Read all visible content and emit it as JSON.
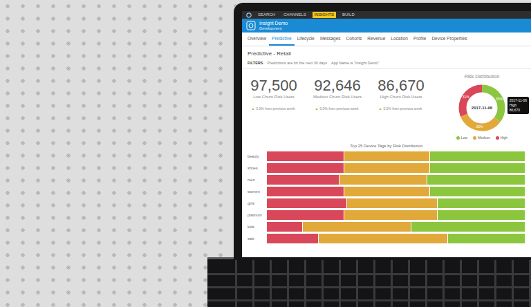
{
  "top_nav": [
    {
      "label": "SEARCH",
      "selected": false
    },
    {
      "label": "CHANNELS",
      "selected": false
    },
    {
      "label": "INSIGHTS",
      "selected": true
    },
    {
      "label": "BUILD",
      "selected": false
    }
  ],
  "app": {
    "title": "Insight Demo",
    "subtitle": "Development"
  },
  "tabs": [
    {
      "label": "Overview",
      "selected": false
    },
    {
      "label": "Predictive",
      "selected": true
    },
    {
      "label": "Lifecycle",
      "selected": false
    },
    {
      "label": "Messages",
      "selected": false
    },
    {
      "label": "Cohorts",
      "selected": false
    },
    {
      "label": "Revenue",
      "selected": false
    },
    {
      "label": "Location",
      "selected": false
    },
    {
      "label": "Profile",
      "selected": false
    },
    {
      "label": "Device Properties",
      "selected": false
    }
  ],
  "page": {
    "title": "Predictive - Retail",
    "filter_label": "FILTERS",
    "filter_text": "Predictions are for the next 30 days",
    "filter_app": "App Name is \"Insight Demo\""
  },
  "stats": [
    {
      "value": "97,500",
      "label": "Low Churn Risk Users",
      "change_icon": "▲",
      "change": "0.0% from previous week"
    },
    {
      "value": "92,646",
      "label": "Medium Churn Risk Users",
      "change_icon": "▲",
      "change": "0.0% from previous week"
    },
    {
      "value": "86,670",
      "label": "High Churn Risk Users",
      "change_icon": "▲",
      "change": "0.0% from previous week"
    }
  ],
  "risk_distribution": {
    "title": "Risk Distribution",
    "date": "2017-11-06",
    "segments": [
      {
        "label": "Low",
        "share": "35%",
        "value": 97500,
        "color": "#8cc63f"
      },
      {
        "label": "Medium",
        "share": "33%",
        "value": 92646,
        "color": "#e0a93a"
      },
      {
        "label": "High",
        "share": "31%",
        "value": 86670,
        "color": "#d9475a"
      }
    ],
    "tooltip": {
      "date": "2017-11-06",
      "label": "High",
      "value": "86,670"
    }
  },
  "chart": {
    "title": "Top 25 Device Tags by Risk Distribution",
    "series": [
      {
        "color": "#d9475a"
      },
      {
        "color": "#e0a93a"
      },
      {
        "color": "#8cc63f"
      }
    ],
    "rows": [
      {
        "label": "beauty",
        "values": [
          30,
          33,
          37
        ]
      },
      {
        "label": "shoes",
        "values": [
          30,
          33,
          37
        ]
      },
      {
        "label": "men",
        "values": [
          28,
          34,
          38
        ]
      },
      {
        "label": "women",
        "values": [
          30,
          33,
          37
        ]
      },
      {
        "label": "girls",
        "values": [
          31,
          35,
          34
        ]
      },
      {
        "label": "platinum",
        "values": [
          30,
          36,
          34
        ]
      },
      {
        "label": "kids",
        "values": [
          14,
          42,
          44
        ]
      },
      {
        "label": "sale",
        "values": [
          20,
          50,
          30
        ]
      }
    ]
  }
}
